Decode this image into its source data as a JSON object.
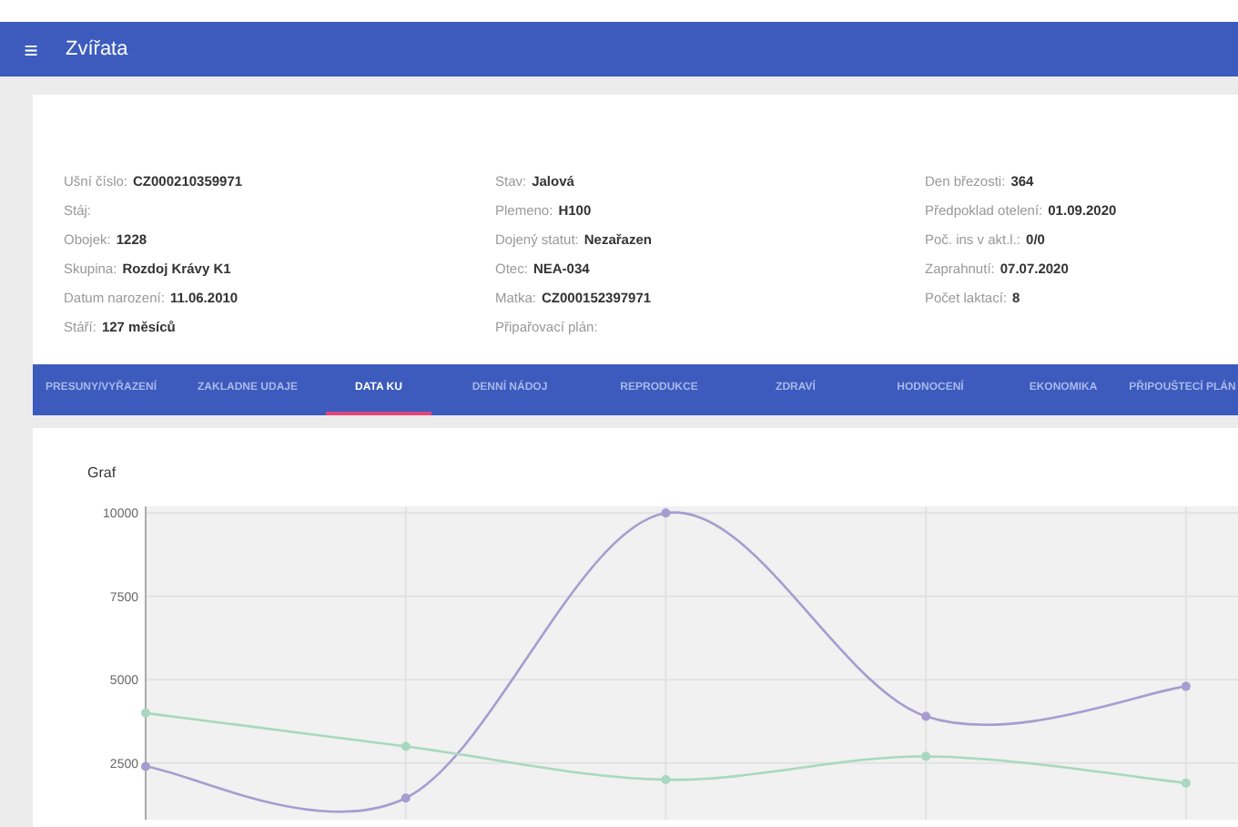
{
  "app_bar": {
    "menu_icon": "≡",
    "title": "Zvířata"
  },
  "info_columns": [
    [
      {
        "label": "Ušní číslo:",
        "value": "CZ000210359971"
      },
      {
        "label": "Stáj:"
      },
      {
        "label": "Obojek:",
        "value": "1228"
      },
      {
        "label": "Skupina:",
        "value": "Rozdoj Krávy K1"
      },
      {
        "label": "Datum narození:",
        "value": "11.06.2010"
      },
      {
        "label": "Stáří:",
        "value": "127 měsíců"
      }
    ],
    [
      {
        "label": "Stav:",
        "value": "Jalová"
      },
      {
        "label": "Plemeno:",
        "value": "H100"
      },
      {
        "label": "Dojený statut:",
        "value": "Nezařazen"
      },
      {
        "label": "Otec:",
        "value": "NEA-034"
      },
      {
        "label": "Matka:",
        "value": "CZ000152397971"
      },
      {
        "label": "Připařovací plán:"
      }
    ],
    [
      {
        "label": "Den březosti:",
        "value": "364"
      },
      {
        "label": "Předpoklad otelení:",
        "value": "01.09.2020"
      },
      {
        "label": "Poč. ins v akt.l.:",
        "value": "0/0"
      },
      {
        "label": "Zaprahnutí:",
        "value": "07.07.2020"
      },
      {
        "label": "Počet laktací:",
        "value": "8"
      }
    ]
  ],
  "tabs": [
    {
      "label": "PRESUNY/VYŘAZENÍ",
      "selected": false
    },
    {
      "label": "ZAKLADNE UDAJE",
      "selected": false
    },
    {
      "label": "DATA KU",
      "selected": true
    },
    {
      "label": "DENNÍ NÁDOJ",
      "selected": false
    },
    {
      "label": "REPRODUKCE",
      "selected": false
    },
    {
      "label": "ZDRAVÍ",
      "selected": false
    },
    {
      "label": "HODNOCENÍ",
      "selected": false
    },
    {
      "label": "EKONOMIKA",
      "selected": false
    },
    {
      "label": "PŘIPOUŠTECÍ PLÁN",
      "selected": false
    }
  ],
  "chart_panel": {
    "title": "Graf",
    "chart_data": {
      "type": "line",
      "grid": true,
      "categories": [
        null,
        null,
        null,
        null,
        null
      ],
      "ylim": [
        800,
        10200
      ],
      "yticks": [
        2500,
        5000,
        7500,
        10000
      ],
      "series": [
        {
          "color": "#a79ccf",
          "marker": "circle",
          "values": [
            2400,
            1450,
            10000,
            3900,
            4800
          ]
        },
        {
          "color": "#a8d8bf",
          "marker": "circle",
          "values": [
            4000,
            3000,
            2000,
            2700,
            1900
          ]
        }
      ]
    }
  }
}
